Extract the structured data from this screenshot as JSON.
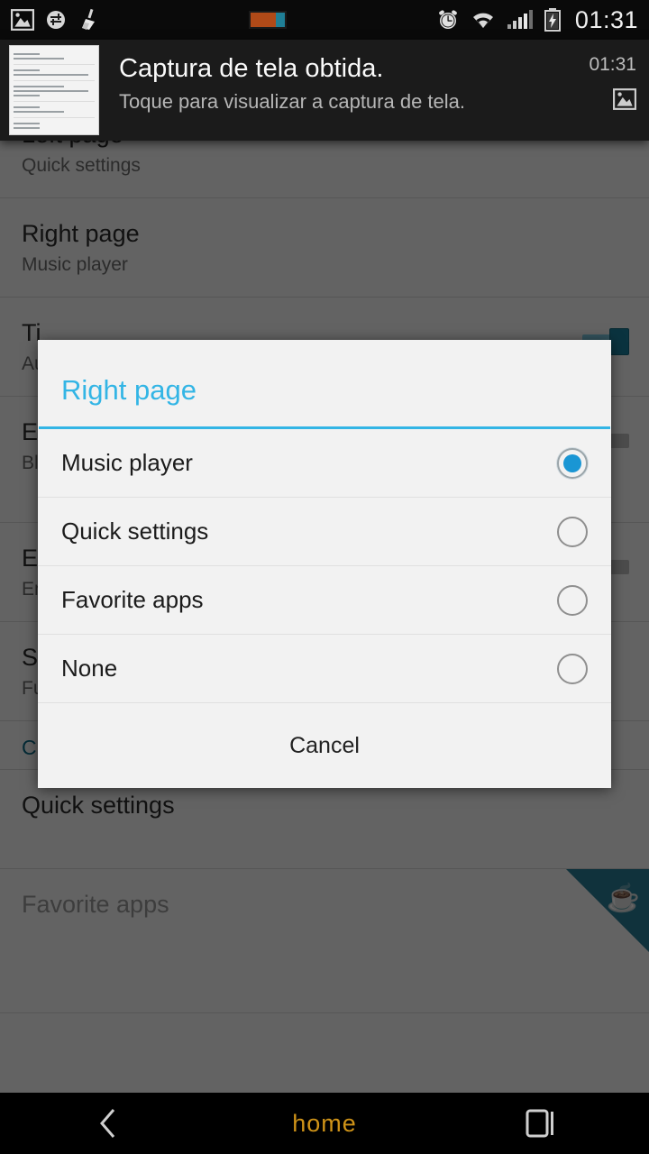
{
  "status_bar": {
    "time": "01:31",
    "left_icons": [
      {
        "name": "image-icon"
      },
      {
        "name": "settings-sync-icon"
      },
      {
        "name": "broom-cleaner-icon"
      }
    ],
    "center_icons": [
      {
        "name": "download-chip-icon"
      }
    ],
    "right_icons": [
      {
        "name": "alarm-clock-icon"
      },
      {
        "name": "wifi-icon"
      },
      {
        "name": "cellular-signal-icon"
      },
      {
        "name": "battery-charging-icon"
      }
    ]
  },
  "notification": {
    "title": "Captura de tela obtida.",
    "subtitle": "Toque para visualizar a captura de tela.",
    "time": "01:31",
    "icon": "image-icon",
    "thumbnail": "screenshot-thumbnail"
  },
  "background": {
    "rows": [
      {
        "title": "Left page",
        "subtitle": "Quick settings",
        "switch": null,
        "disabled": false
      },
      {
        "title": "Right page",
        "subtitle": "Music player",
        "switch": null,
        "disabled": false
      },
      {
        "title": "Ti",
        "subtitle": "Au",
        "switch": "on",
        "disabled": false
      },
      {
        "title": "Ec",
        "subtitle": "Bl ta",
        "switch": "off",
        "disabled": false
      },
      {
        "title": "En",
        "subtitle": "En",
        "switch": "off",
        "disabled": false
      },
      {
        "title": "Sw",
        "subtitle": "Fu",
        "switch": null,
        "disabled": false
      }
    ],
    "section_header": "Custom pages",
    "custom_rows": [
      {
        "title": "Quick settings",
        "disabled": false
      },
      {
        "title": "Favorite apps",
        "disabled": true
      }
    ],
    "ribbon_icon": "coffee-cup-icon"
  },
  "dialog": {
    "title": "Right page",
    "accent_color": "#33b5e5",
    "options": [
      {
        "label": "Music player",
        "selected": true
      },
      {
        "label": "Quick settings",
        "selected": false
      },
      {
        "label": "Favorite apps",
        "selected": false
      },
      {
        "label": "None",
        "selected": false
      }
    ],
    "cancel_label": "Cancel"
  },
  "nav_bar": {
    "back_icon": "back-chevron-icon",
    "home_label": "home",
    "recents_icon": "recents-square-icon",
    "home_color": "#cf9318"
  }
}
